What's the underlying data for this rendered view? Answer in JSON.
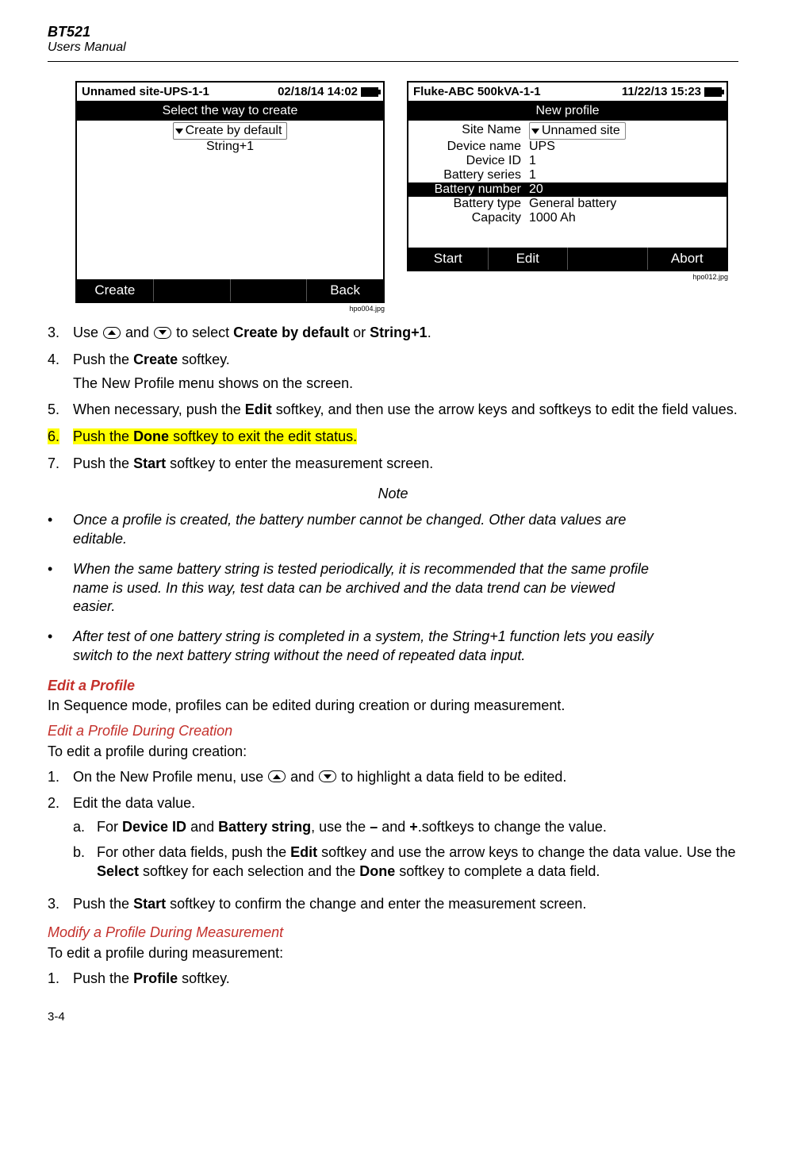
{
  "header": {
    "title": "BT521",
    "subtitle": "Users Manual"
  },
  "screen1": {
    "titleLeft": "Unnamed site-UPS-1-1",
    "titleRight": "02/18/14 14:02",
    "heading": "Select the way to create",
    "selected": "Create by default",
    "option2": "String+1",
    "softkey1": "Create",
    "softkey4": "Back",
    "caption": "hpo004.jpg"
  },
  "screen2": {
    "titleLeft": "Fluke-ABC 500kVA-1-1",
    "titleRight": "11/22/13 15:23",
    "heading": "New profile",
    "rows": {
      "siteNameLabel": "Site Name",
      "siteNameValue": "Unnamed site",
      "deviceNameLabel": "Device name",
      "deviceNameValue": "UPS",
      "deviceIdLabel": "Device ID",
      "deviceIdValue": "1",
      "batterySeriesLabel": "Battery series",
      "batterySeriesValue": "1",
      "batteryNumberLabel": "Battery number",
      "batteryNumberValue": "20",
      "batteryTypeLabel": "Battery type",
      "batteryTypeValue": "General battery",
      "capacityLabel": "Capacity",
      "capacityValue": "1000 Ah"
    },
    "softkey1": "Start",
    "softkey2": "Edit",
    "softkey4": "Abort",
    "caption": "hpo012.jpg"
  },
  "steps": {
    "s3a": "Use ",
    "s3b": " and ",
    "s3c": " to select ",
    "s3d": "Create by default",
    "s3e": " or ",
    "s3f": "String+1",
    "s3g": ".",
    "s4a": "Push the ",
    "s4b": "Create",
    "s4c": " softkey.",
    "s4sub": "The New Profile menu shows on the screen.",
    "s5a": "When necessary, push the ",
    "s5b": "Edit",
    "s5c": " softkey, and then use the arrow keys and softkeys to edit the field values.",
    "s6a": "Push the ",
    "s6b": "Done",
    "s6c": " softkey to exit the edit status.",
    "s7a": "Push the ",
    "s7b": "Start",
    "s7c": " softkey to enter the measurement screen."
  },
  "noteHeading": "Note",
  "notes": {
    "n1": "Once a profile is created, the battery number cannot be changed. Other data values are editable.",
    "n2": "When the same battery string is tested periodically, it is recommended that the same profile name is used. In this way, test data can be archived and the data trend can be viewed easier.",
    "n3": "After test of one battery string is completed in a system, the String+1 function lets you easily switch to the next battery string without the need of repeated data input."
  },
  "editProfile": {
    "heading": "Edit a Profile",
    "intro": "In Sequence mode, profiles can be edited during creation or during measurement."
  },
  "editCreation": {
    "heading": "Edit a Profile During Creation",
    "intro": "To edit a profile during creation:",
    "s1a": "On the New Profile menu, use ",
    "s1b": " and ",
    "s1c": " to highlight a data field to be edited.",
    "s2": "Edit the data value.",
    "s2a1": "For ",
    "s2a2": "Device ID",
    "s2a3": " and ",
    "s2a4": "Battery string",
    "s2a5": ", use the ",
    "s2a6": "–",
    "s2a7": " and ",
    "s2a8": "+",
    "s2a9": ".softkeys to change the value.",
    "s2b1": "For other data fields, push the ",
    "s2b2": "Edit",
    "s2b3": " softkey and use the arrow keys to change the data value. Use the ",
    "s2b4": "Select",
    "s2b5": " softkey for each selection and the ",
    "s2b6": "Done",
    "s2b7": " softkey to complete a data field.",
    "s3a": "Push the ",
    "s3b": "Start",
    "s3c": " softkey to confirm the change and enter the measurement screen."
  },
  "modifyMeasure": {
    "heading": "Modify a Profile During Measurement",
    "intro": "To edit a profile during measurement:",
    "s1a": "Push the ",
    "s1b": "Profile",
    "s1c": " softkey."
  },
  "pageNum": "3-4"
}
